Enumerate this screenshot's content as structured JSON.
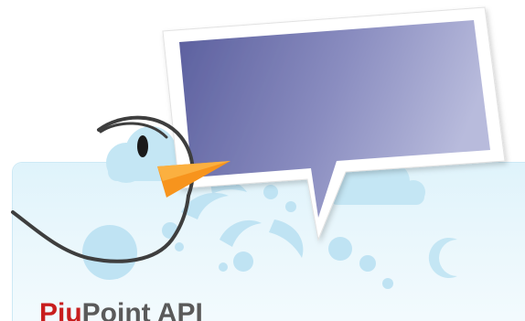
{
  "banner": {
    "brand_prefix": "Piu",
    "brand_rest": "Point API"
  },
  "icons": {
    "mascot": "bird-mascot-icon",
    "speech_bubble": "speech-bubble-icon",
    "moon": "crescent-moon-icon",
    "clouds": "cloud-icon"
  },
  "colors": {
    "beak": "#f7941d",
    "brand_accent": "#c81e1e",
    "brand_text": "#5a5a5a",
    "bubble_start": "#5b5f9e",
    "bubble_end": "#b5b8da",
    "panel_sky": "#dff3fb",
    "decor_blue": "#bfe3f3"
  }
}
